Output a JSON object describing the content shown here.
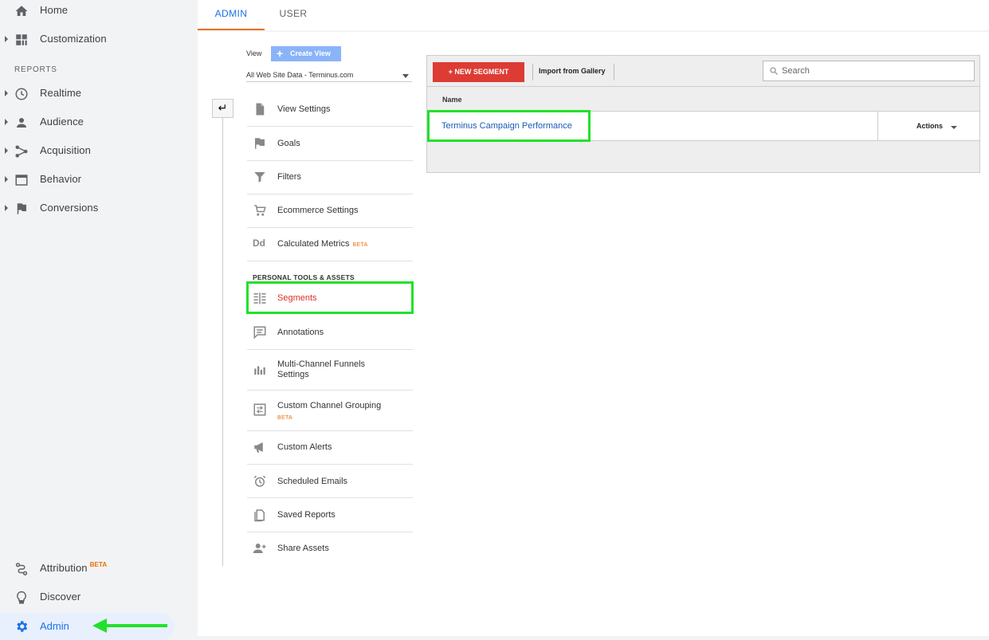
{
  "sidebar": {
    "items": [
      {
        "label": "Home",
        "icon": "home-icon"
      },
      {
        "label": "Customization",
        "icon": "dashboard-icon"
      },
      {
        "label": "Realtime",
        "icon": "clock-icon"
      },
      {
        "label": "Audience",
        "icon": "person-icon"
      },
      {
        "label": "Acquisition",
        "icon": "acquisition-icon"
      },
      {
        "label": "Behavior",
        "icon": "behavior-icon"
      },
      {
        "label": "Conversions",
        "icon": "flag-icon"
      }
    ],
    "reports_heading": "REPORTS",
    "bottom": {
      "attribution_label": "Attribution",
      "attribution_badge": "BETA",
      "discover_label": "Discover",
      "admin_label": "Admin"
    }
  },
  "tabs": {
    "admin": "ADMIN",
    "user": "USER"
  },
  "view": {
    "label": "View",
    "create_view": "Create View",
    "selected": "All Web Site Data - Terminus.com"
  },
  "menu": {
    "view_settings": "View Settings",
    "goals": "Goals",
    "filters": "Filters",
    "ecommerce": "Ecommerce Settings",
    "calculated_metrics": "Calculated Metrics",
    "calculated_metrics_badge": "BETA",
    "section_heading": "PERSONAL TOOLS & ASSETS",
    "segments": "Segments",
    "annotations": "Annotations",
    "mcf_line1": "Multi-Channel Funnels",
    "mcf_line2": "Settings",
    "custom_channel": "Custom Channel Grouping",
    "custom_channel_badge": "BETA",
    "custom_alerts": "Custom Alerts",
    "scheduled_emails": "Scheduled Emails",
    "saved_reports": "Saved Reports",
    "share_assets": "Share Assets"
  },
  "segments_panel": {
    "new_segment": "+ NEW SEGMENT",
    "import_gallery": "Import from Gallery",
    "search_placeholder": "Search",
    "column_name": "Name",
    "rows": [
      {
        "name": "Terminus Campaign Performance",
        "actions": "Actions"
      }
    ]
  },
  "colors": {
    "accent": "#1a73e8",
    "tab_underline": "#e8710a",
    "new_segment_bg": "#dd3c34",
    "highlight_box": "#22e12a",
    "segments_active": "#d93025"
  }
}
